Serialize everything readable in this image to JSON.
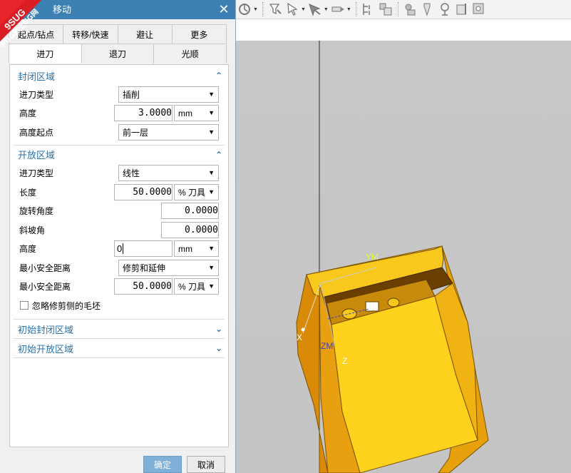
{
  "dialog": {
    "title": "移动",
    "badge_top": "9SUG",
    "badge_bottom": "学UG就上UG网",
    "close": "✕",
    "tabs_row1": [
      "起点/钻点",
      "转移/快速",
      "避让",
      "更多"
    ],
    "tabs_row2": [
      "进刀",
      "退刀",
      "光顺"
    ],
    "active_tab": "进刀",
    "sections": {
      "closed": {
        "title": "封闭区域",
        "rows": {
          "engage_type_label": "进刀类型",
          "engage_type_value": "插削",
          "height_label": "高度",
          "height_value": "3.0000",
          "height_unit": "mm",
          "height_from_label": "高度起点",
          "height_from_value": "前一层"
        }
      },
      "open": {
        "title": "开放区域",
        "rows": {
          "engage_type_label": "进刀类型",
          "engage_type_value": "线性",
          "length_label": "长度",
          "length_value": "50.0000",
          "length_unit": "% 刀具",
          "rotation_label": "旋转角度",
          "rotation_value": "0.0000",
          "ramp_label": "斜坡角",
          "ramp_value": "0.0000",
          "height_label": "高度",
          "height_value": "0",
          "height_unit": "mm",
          "min_clear_label1": "最小安全距离",
          "min_clear_value1": "修剪和延伸",
          "min_clear_label2": "最小安全距离",
          "min_clear_value2": "50.0000",
          "min_clear_unit2": "% 刀具",
          "ignore_label": "忽略修剪侧的毛坯"
        }
      },
      "init_closed": {
        "title": "初始封闭区域"
      },
      "init_open": {
        "title": "初始开放区域"
      }
    },
    "ok": "确定",
    "cancel": "取消"
  },
  "viewport": {
    "axis_labels": [
      "YM",
      "X",
      "ZM",
      "Z"
    ],
    "part_color": "#f5bb10",
    "edge_color": "#7a5200"
  },
  "colors": {
    "titlebar": "#3d80b4",
    "section_title": "#2a72a8",
    "ok_button": "#7fb0d8"
  }
}
